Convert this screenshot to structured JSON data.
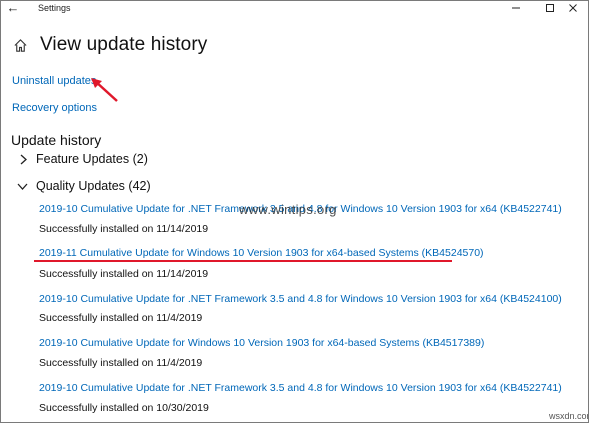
{
  "window": {
    "title": "Settings",
    "back_glyph": "←",
    "minimize_label": "minimize",
    "maximize_label": "maximize",
    "close_label": "close"
  },
  "header": {
    "title": "View update history",
    "home_icon": "home-icon"
  },
  "links": {
    "uninstall": "Uninstall updates",
    "recovery": "Recovery options"
  },
  "history": {
    "heading": "Update history",
    "feature_group": "Feature Updates (2)",
    "quality_group": "Quality Updates (42)",
    "items": [
      {
        "title": "2019-10 Cumulative Update for .NET Framework 3.5 and 4.8 for Windows 10 Version 1903 for x64 (KB4522741)",
        "status": "Successfully installed on 11/14/2019"
      },
      {
        "title": "2019-11 Cumulative Update for Windows 10 Version 1903 for x64-based Systems (KB4524570)",
        "status": "Successfully installed on 11/14/2019"
      },
      {
        "title": "2019-10 Cumulative Update for .NET Framework 3.5 and 4.8 for Windows 10 Version 1903 for x64 (KB4524100)",
        "status": "Successfully installed on 11/4/2019"
      },
      {
        "title": "2019-10 Cumulative Update for Windows 10 Version 1903 for x64-based Systems (KB4517389)",
        "status": "Successfully installed on 11/4/2019"
      },
      {
        "title": "2019-10 Cumulative Update for .NET Framework 3.5 and 4.8 for Windows 10 Version 1903 for x64 (KB4522741)",
        "status": "Successfully installed on 10/30/2019"
      }
    ]
  },
  "watermark": "www.wintips.org",
  "corner_mark": "wsxdn.com",
  "colors": {
    "link": "#0067b8",
    "highlight": "#e0182b"
  }
}
